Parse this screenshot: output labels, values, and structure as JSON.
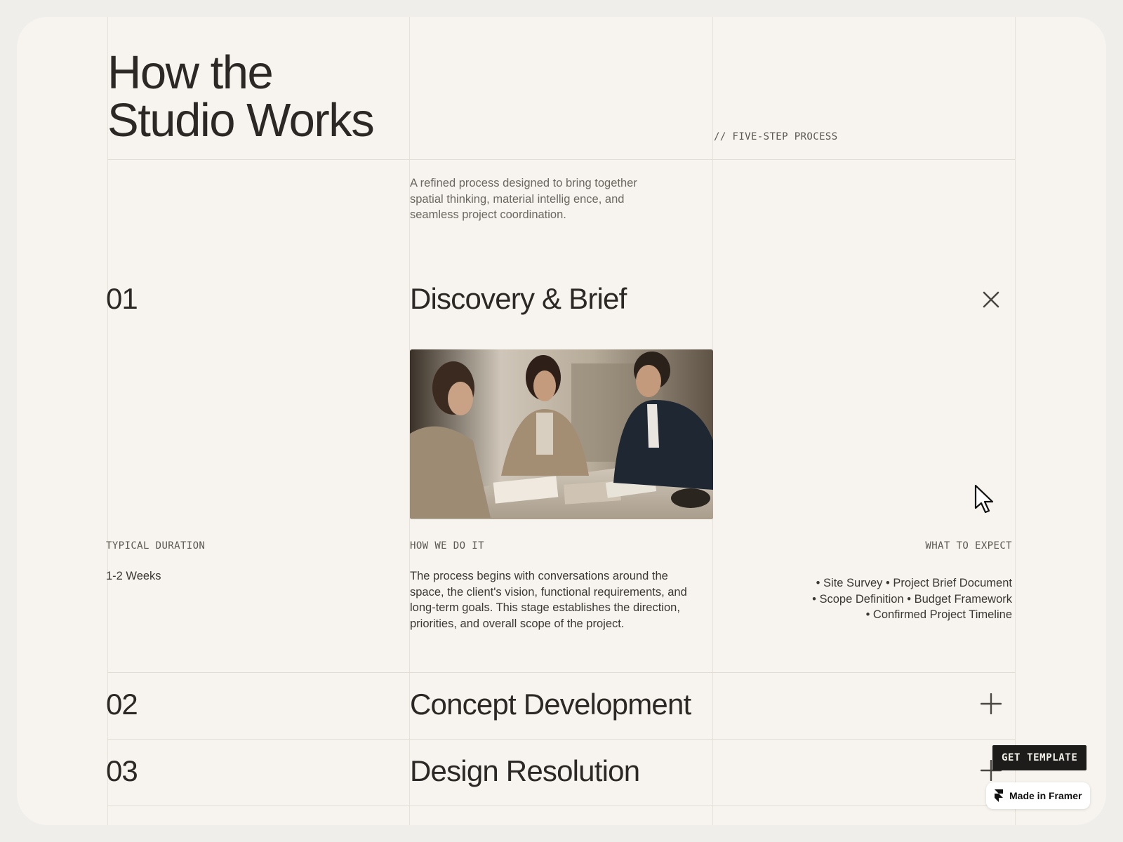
{
  "header": {
    "title_line1": "How the",
    "title_line2": "Studio Works",
    "kicker": "// FIVE-STEP PROCESS",
    "intro": "A refined process designed to bring together spatial thinking, material intellig ence, and seamless project coordination."
  },
  "steps": [
    {
      "number": "01",
      "title": "Discovery & Brief",
      "expanded": true,
      "toggle_icon": "close-icon",
      "photo_alt": "Three people meeting around a table with material samples",
      "duration_label": "TYPICAL DURATION",
      "duration_value": "1-2 Weeks",
      "how_label": "HOW WE DO IT",
      "how_text": "The process begins with conversations around the space, the client's vision, functional requirements, and long-term goals. This stage establishes the direction, priorities, and overall scope of the project.",
      "expect_label": "WHAT TO EXPECT",
      "expect_line1": "• Site Survey • Project Brief Document",
      "expect_line2": "• Scope Definition • Budget Framework",
      "expect_line3": "• Confirmed Project Timeline"
    },
    {
      "number": "02",
      "title": "Concept Development",
      "expanded": false,
      "toggle_icon": "plus-icon"
    },
    {
      "number": "03",
      "title": "Design Resolution",
      "expanded": false,
      "toggle_icon": "plus-icon"
    }
  ],
  "overlay": {
    "get_template": "GET TEMPLATE",
    "made_in_framer": "Made in Framer"
  },
  "colors": {
    "background": "#f7f4ef",
    "text": "#2b2825",
    "muted": "#6b6760",
    "grid_line": "#e6e1d9",
    "button_dark": "#1d1c1b"
  }
}
